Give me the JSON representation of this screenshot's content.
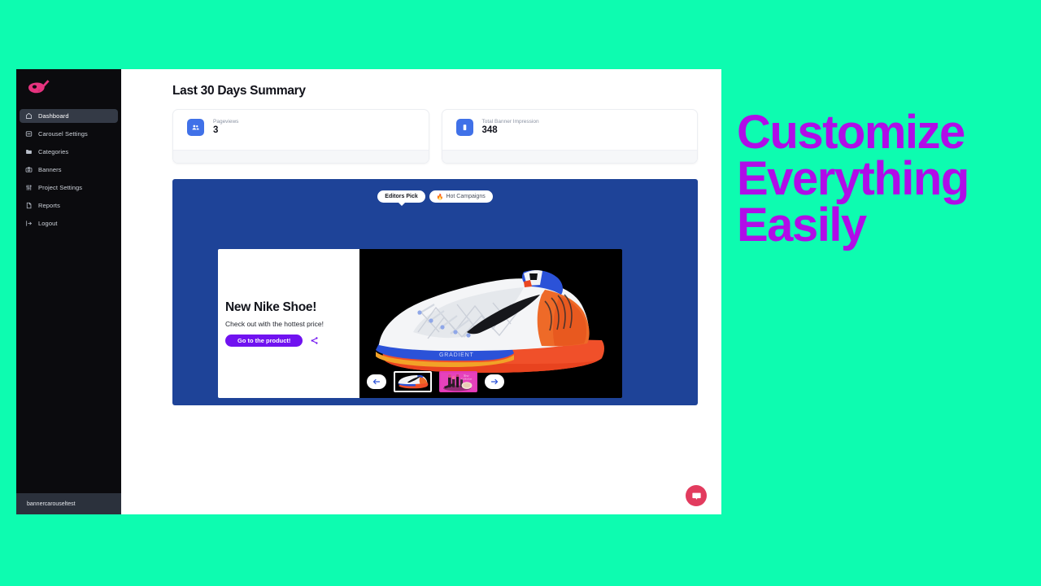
{
  "theme": {
    "page_background": "#0dfcb0",
    "sidebar_background": "#0b0b0e",
    "accent_blue": "#4071e8",
    "banner_blue": "#1e4398",
    "cta_purple": "#7012f0",
    "marketing_purple": "#b00ce8",
    "chat_pink": "#e23b5e",
    "logo_pink": "#e6337f"
  },
  "sidebar": {
    "logo_name": "paint-palette-logo",
    "items": [
      {
        "label": "Dashboard",
        "icon": "home-icon",
        "active": true
      },
      {
        "label": "Carousel Settings",
        "icon": "layout-panel-icon",
        "active": false
      },
      {
        "label": "Categories",
        "icon": "folder-icon",
        "active": false
      },
      {
        "label": "Banners",
        "icon": "camera-icon",
        "active": false
      },
      {
        "label": "Project Settings",
        "icon": "sliders-icon",
        "active": false
      },
      {
        "label": "Reports",
        "icon": "file-document-icon",
        "active": false
      },
      {
        "label": "Logout",
        "icon": "logout-arrow-icon",
        "active": false
      }
    ],
    "footer_project": "bannercarouseltest"
  },
  "main": {
    "page_title": "Last 30 Days Summary",
    "stats": [
      {
        "label": "Pageviews",
        "value": "3",
        "icon": "users-group-icon"
      },
      {
        "label": "Total Banner Impression",
        "value": "348",
        "icon": "banner-rect-icon"
      }
    ]
  },
  "carousel": {
    "tabs": [
      {
        "label": "Editors Pick",
        "emoji": "",
        "active": true
      },
      {
        "label": "Hot Campaigns",
        "emoji": "🔥",
        "active": false
      }
    ],
    "slide": {
      "headline": "New Nike Shoe!",
      "subtext": "Check out with the hottest price!",
      "cta_label": "Go to the product!",
      "share_icon": "share-icon",
      "image_alt": "nike-running-shoe"
    },
    "nav": {
      "prev_icon": "arrow-left-icon",
      "next_icon": "arrow-right-icon",
      "thumbnails": [
        {
          "name": "nike-shoe-thumbnail",
          "active": true
        },
        {
          "name": "cosmetics-thumbnail",
          "active": false
        }
      ]
    }
  },
  "chat": {
    "icon": "chat-bubble-icon"
  },
  "marketing": {
    "lines": [
      "Customize",
      "Everything",
      "Easily"
    ]
  }
}
